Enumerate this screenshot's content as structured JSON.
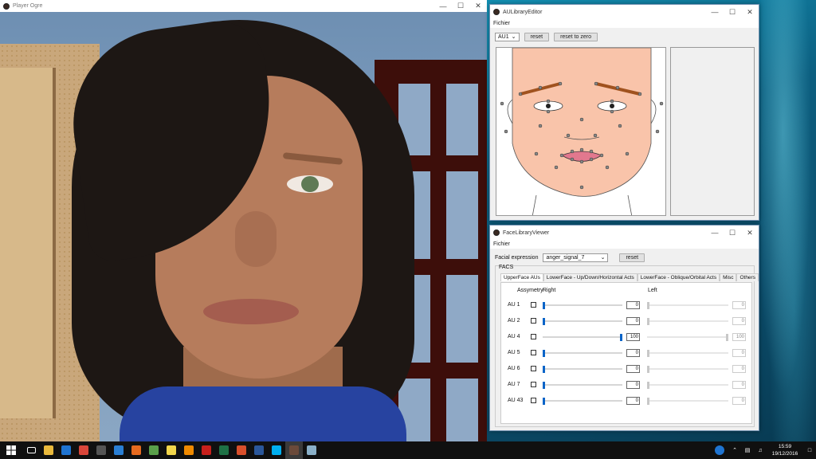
{
  "player": {
    "title": "Player Ogre"
  },
  "aulib": {
    "title": "AULibraryEditor",
    "menu": "Fichier",
    "au_select": "AU1",
    "reset_label": "reset",
    "reset_zero_label": "reset to zero"
  },
  "facelib": {
    "title": "FaceLibraryViewer",
    "menu": "Fichier",
    "expression_label": "Facial expression",
    "expression_value": "anger_signal_7",
    "reset_label": "reset",
    "facs_title": "FACS",
    "tabs": [
      "UpperFace AUs",
      "LowerFace - Up/Down/Horizontal Acts",
      "LowerFace - Oblique/Orbital Acts",
      "Misc",
      "Others"
    ],
    "col_asymmetry": "Assymetry",
    "col_right": "Right",
    "col_left": "Left",
    "rows": [
      {
        "label": "AU 1",
        "right": "0",
        "left": "0",
        "right_level": 0,
        "left_level": 0,
        "left_enabled": false
      },
      {
        "label": "AU 2",
        "right": "0",
        "left": "0",
        "right_level": 0,
        "left_level": 0,
        "left_enabled": false
      },
      {
        "label": "AU 4",
        "right": "100",
        "left": "100",
        "right_level": 100,
        "left_level": 100,
        "left_enabled": false
      },
      {
        "label": "AU 5",
        "right": "0",
        "left": "0",
        "right_level": 0,
        "left_level": 0,
        "left_enabled": false
      },
      {
        "label": "AU 6",
        "right": "0",
        "left": "0",
        "right_level": 0,
        "left_level": 0,
        "left_enabled": false
      },
      {
        "label": "AU 7",
        "right": "0",
        "left": "0",
        "right_level": 0,
        "left_level": 0,
        "left_enabled": false
      },
      {
        "label": "AU 43",
        "right": "0",
        "left": "0",
        "right_level": 0,
        "left_level": 0,
        "left_enabled": false
      }
    ]
  },
  "taskbar": {
    "time": "15:59",
    "date": "19/12/2016",
    "apps": [
      "file-explorer",
      "edge",
      "chrome",
      "store",
      "edge-alt",
      "firefox",
      "notepad",
      "sticky",
      "vlc",
      "acrobat",
      "excel",
      "paint",
      "word",
      "skype",
      "ogre",
      "other"
    ]
  },
  "colors": {
    "accent": "#0a64c8",
    "skin": "#f9c4aa",
    "brow": "#a0521e"
  }
}
